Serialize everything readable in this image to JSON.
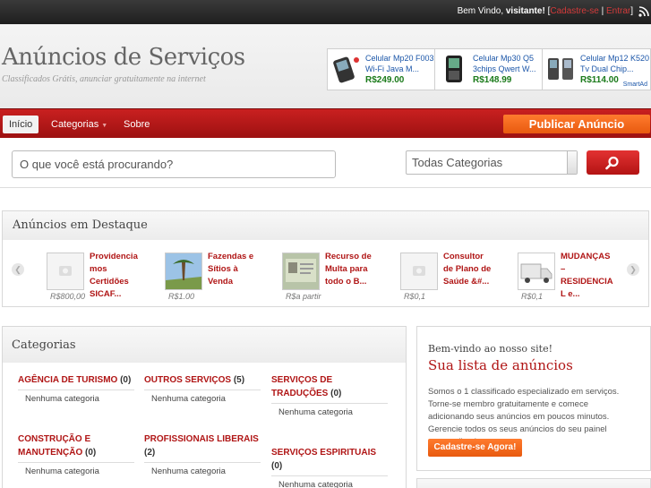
{
  "topbar": {
    "welcome_prefix": "Bem Vindo,",
    "user": "visitante!",
    "bracket_open": "[",
    "register_link": "Cadastre-se",
    "separator": "|",
    "login_link": "Entrar",
    "bracket_close": "]",
    "rss_icon": "rss-icon"
  },
  "header": {
    "site_title": "Anúncios de Serviços",
    "tagline": "Classificados Grátis, anunciar gratuitamente na internet"
  },
  "ad_banner": {
    "items": [
      {
        "title_line1": "Celular Mp20 F003",
        "title_line2": "Wi-Fi Java M...",
        "price": "R$249.00"
      },
      {
        "title_line1": "Celular Mp30 Q5",
        "title_line2": "3chips Qwert W...",
        "price": "R$148.99"
      },
      {
        "title_line1": "Celular Mp12 K520",
        "title_line2": "Tv Dual Chip...",
        "price": "R$114.00"
      }
    ],
    "brand": "SmartAd"
  },
  "nav": {
    "items": [
      {
        "label": "Início"
      },
      {
        "label": "Categorias"
      },
      {
        "label": "Sobre"
      }
    ],
    "publish_label": "Publicar Anúncio"
  },
  "search": {
    "placeholder": "O que você está procurando?",
    "category_selected": "Todas Categorias",
    "button_icon": "search-icon"
  },
  "featured": {
    "title": "Anúncios em Destaque",
    "items": [
      {
        "title": "Providencia mos Certidões SICAF...",
        "price": "R$800,00"
      },
      {
        "title": "Fazendas e Sítios à Venda",
        "price": "R$1.00"
      },
      {
        "title": "Recurso de Multa para todo o B...",
        "price": "R$a partir"
      },
      {
        "title": "Consultor de Plano de Saúde &#...",
        "price": "R$0,1"
      },
      {
        "title": "MUDANÇAS – RESIDENCIA L e...",
        "price": "R$0,1"
      }
    ]
  },
  "categories": {
    "title": "Categorias",
    "items": [
      {
        "name": "AGÊNCIA DE TURISMO",
        "count": "(0)",
        "sub": "Nenhuma categoria"
      },
      {
        "name": "OUTROS SERVIÇOS",
        "count": "(5)",
        "sub": "Nenhuma categoria"
      },
      {
        "name": "SERVIÇOS DE TRADUÇÕES",
        "count": "(0)",
        "sub": "Nenhuma categoria"
      },
      {
        "name": "CONSTRUÇÃO E MANUTENÇÃO",
        "count": "(0)",
        "sub": "Nenhuma categoria"
      },
      {
        "name": "PROFISSIONAIS LIBERAIS",
        "count": "(2)",
        "sub": "Nenhuma categoria"
      },
      {
        "name": "SERVIÇOS ESPIRITUAIS",
        "count": "(0)",
        "sub": "Nenhuma categoria"
      }
    ]
  },
  "welcome_box": {
    "small_title": "Bem-vindo ao nosso site!",
    "big_title": "Sua lista de anúncios",
    "text": "Somos o 1 classificado especializado em serviços. Torne-se membro gratuitamente e comece adicionando seus anúncios em poucos minutos. Gerencie todos os seus anúncios do seu painel personalizado.",
    "button_label": "Cadastre-se Agora!"
  },
  "colors": {
    "brand_red": "#b01515",
    "accent_orange": "#f06a1e",
    "link_blue": "#1a55a8",
    "price_green": "#1a7a1a"
  }
}
